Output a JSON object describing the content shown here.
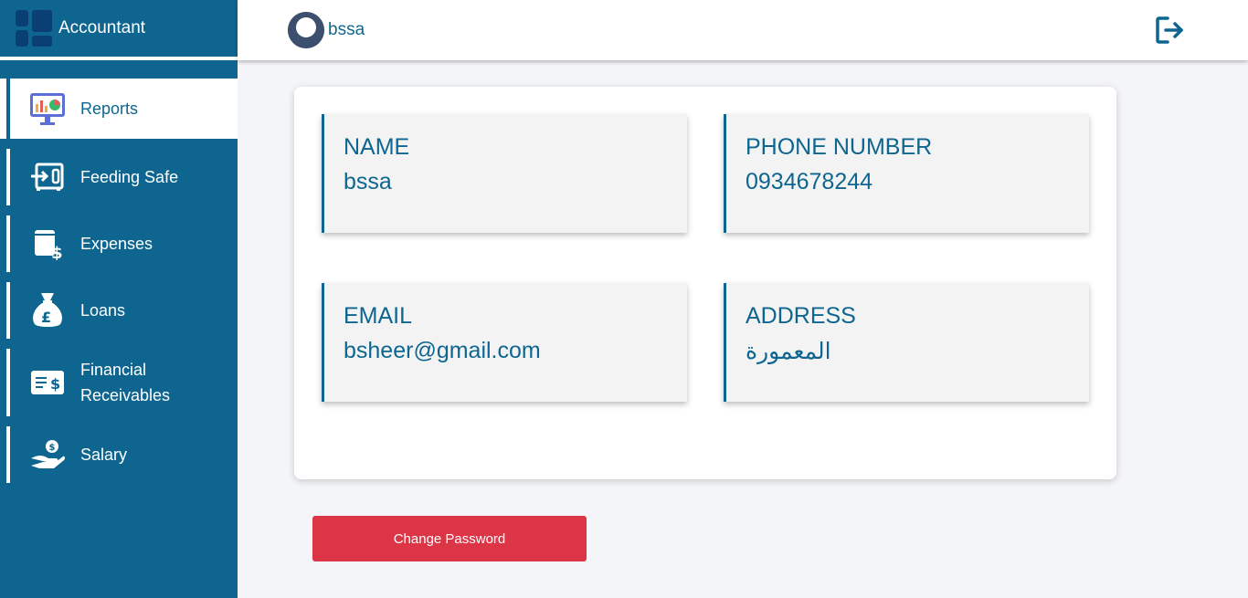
{
  "app": {
    "title": "Accountant"
  },
  "sidebar": {
    "items": [
      {
        "label": "Reports",
        "icon": "reports-icon",
        "active": true
      },
      {
        "label": "Feeding Safe",
        "icon": "feeding-safe-icon"
      },
      {
        "label": "Expenses",
        "icon": "expenses-icon"
      },
      {
        "label": "Loans",
        "icon": "loans-icon"
      },
      {
        "label": "Financial Receivables",
        "icon": "receivables-icon"
      },
      {
        "label": "Salary",
        "icon": "salary-icon"
      }
    ]
  },
  "header": {
    "username": "bssa",
    "logout_icon": "logout-icon"
  },
  "profile": {
    "name_label": "NAME",
    "name_value": "bssa",
    "phone_label": "PHONE NUMBER",
    "phone_value": "0934678244",
    "email_label": "EMAIL",
    "email_value": "bsheer@gmail.com",
    "address_label": "ADDRESS",
    "address_value": "المعمورة"
  },
  "actions": {
    "change_password": "Change Password"
  },
  "colors": {
    "primary": "#0e6690",
    "danger": "#dc3545",
    "background": "#f4f5f8"
  }
}
